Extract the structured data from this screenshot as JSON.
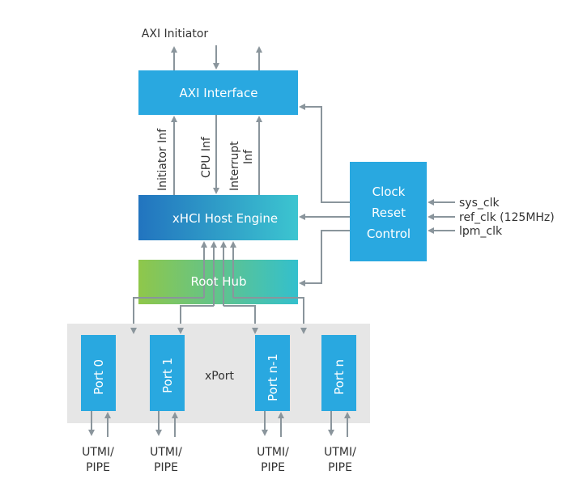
{
  "title": "AXI Initiator",
  "blocks": {
    "axi": "AXI Interface",
    "xhci": "xHCI Host Engine",
    "roothub": "Root Hub",
    "clock": [
      "Clock",
      "Reset",
      "Control"
    ],
    "xport": "xPort"
  },
  "interfaces": {
    "initiator": "Initiator Inf",
    "cpu": "CPU Inf",
    "interrupt": [
      "Interrupt",
      "Inf"
    ]
  },
  "clocks": [
    "sys_clk",
    "ref_clk (125MHz)",
    "lpm_clk"
  ],
  "ports": [
    {
      "label": "Port 0",
      "io": [
        "UTMI/",
        "PIPE"
      ]
    },
    {
      "label": "Port 1",
      "io": [
        "UTMI/",
        "PIPE"
      ]
    },
    {
      "label": "Port n-1",
      "io": [
        "UTMI/",
        "PIPE"
      ]
    },
    {
      "label": "Port n",
      "io": [
        "UTMI/",
        "PIPE"
      ]
    }
  ],
  "colors": {
    "block": "#29a8e0",
    "arrow": "#8a959c",
    "xport_bg": "#e6e6e6"
  }
}
